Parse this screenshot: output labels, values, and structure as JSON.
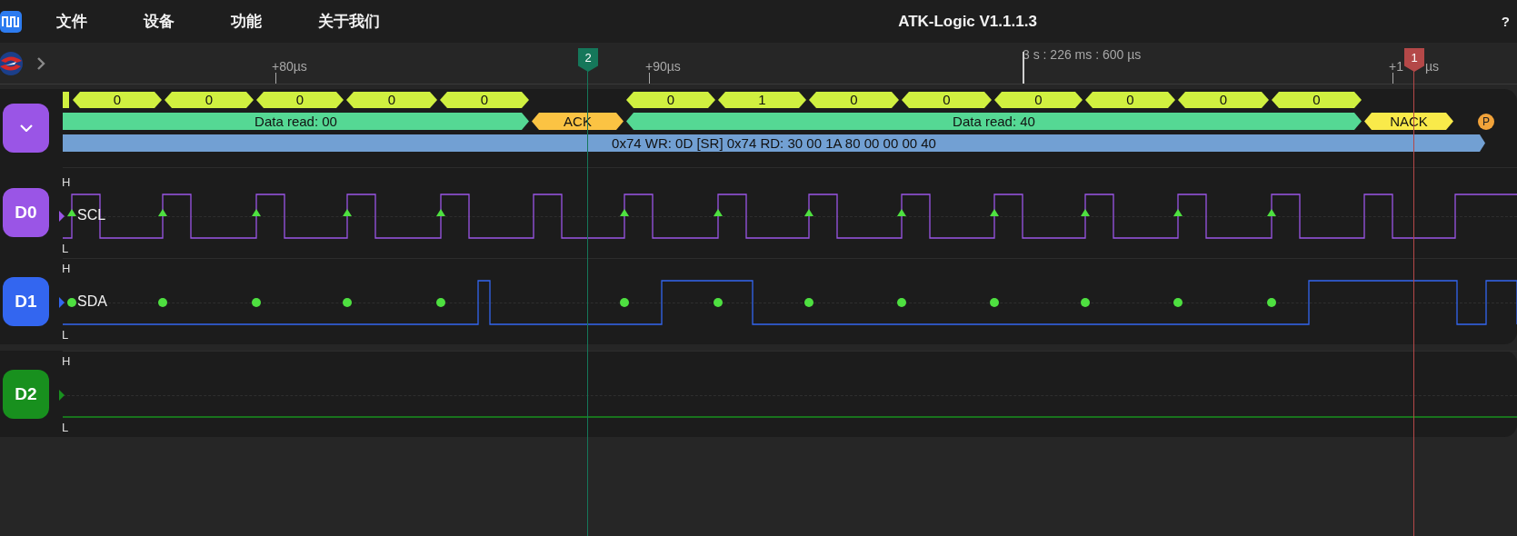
{
  "menu": {
    "items": [
      "文件",
      "设备",
      "功能",
      "关于我们"
    ]
  },
  "window": {
    "title": "ATK-Logic V1.1.1.3",
    "help": "?"
  },
  "ruler": {
    "ticks": [
      {
        "text": "+80µs"
      },
      {
        "text": "+90µs"
      },
      {
        "text": "+1",
        "after_cursor": "µs"
      }
    ],
    "marker": "3 s : 226 ms : 600 µs"
  },
  "cursors": [
    {
      "label": "2",
      "color": "#15775a"
    },
    {
      "label": "1",
      "color": "#b44848"
    }
  ],
  "decoder": {
    "bits": [
      "0",
      "0",
      "0",
      "0",
      "0",
      "0",
      "1",
      "0",
      "0",
      "0",
      "0",
      "0",
      "0"
    ],
    "fields": [
      {
        "kind": "data",
        "text": "Data read: 00"
      },
      {
        "kind": "ack",
        "text": "ACK"
      },
      {
        "kind": "data",
        "text": "Data read: 40"
      },
      {
        "kind": "nack",
        "text": "NACK"
      },
      {
        "kind": "stop",
        "text": "P"
      }
    ],
    "transaction": "0x74 WR: 0D [SR] 0x74 RD: 30 00 1A 80 00 00 00 40"
  },
  "channels": [
    {
      "kind": "clock",
      "badge": "D0",
      "name": "SCL",
      "high": "H",
      "low": "L",
      "color": "#9a55e6"
    },
    {
      "kind": "data",
      "badge": "D1",
      "name": "SDA",
      "high": "H",
      "low": "L",
      "color": "#3366f0"
    },
    {
      "kind": "idle",
      "badge": "D2",
      "high": "H",
      "low": "L",
      "color": "#18901e"
    }
  ]
}
